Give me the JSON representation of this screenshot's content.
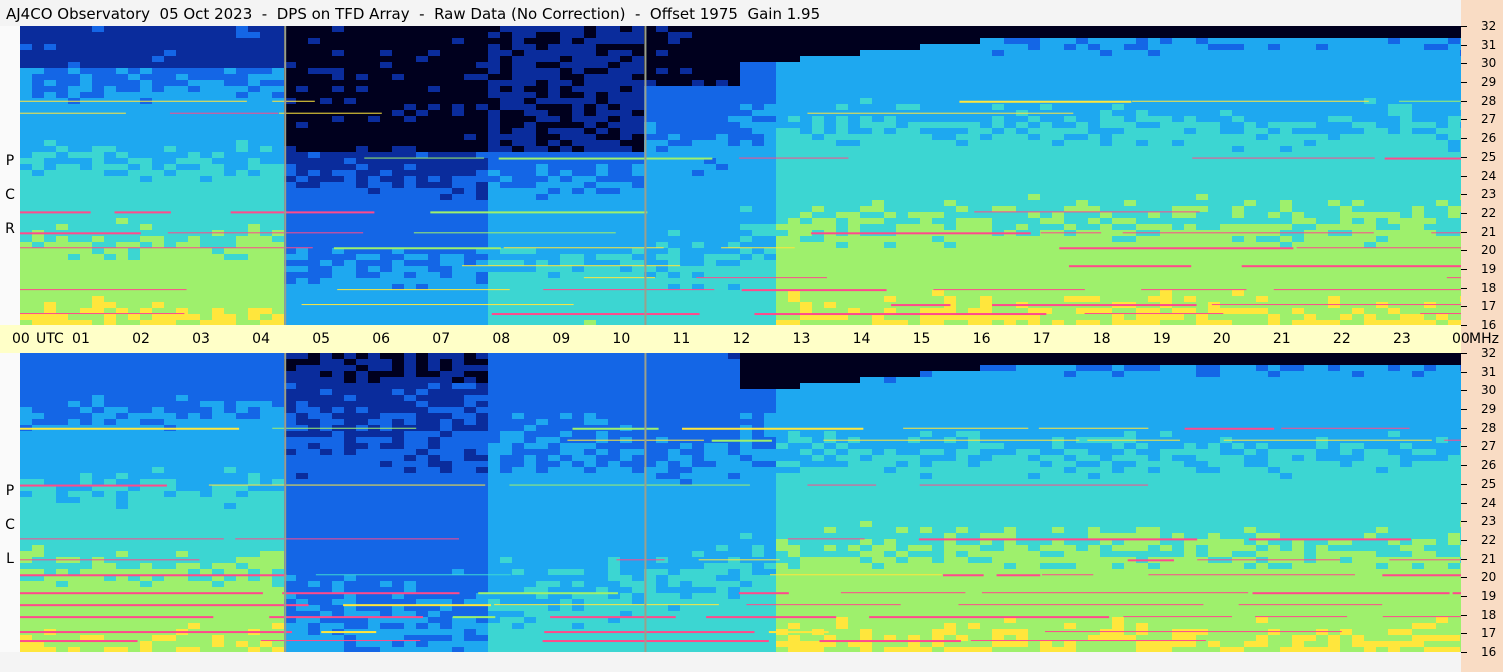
{
  "header": {
    "title": "AJ4CO Observatory  05 Oct 2023  -  DPS on TFD Array  -  Raw Data (No Correction)  -  Offset 1975  Gain 1.95"
  },
  "panels": {
    "top": {
      "label": [
        "R",
        "C",
        "P"
      ]
    },
    "bottom": {
      "label": [
        "L",
        "C",
        "P"
      ]
    }
  },
  "chart_data": {
    "type": "heatmap",
    "title": "AJ4CO Observatory  05 Oct 2023  -  DPS on TFD Array  -  Raw Data (No Correction)  -  Offset 1975  Gain 1.95",
    "x_ticks": [
      "00",
      "01",
      "02",
      "03",
      "04",
      "05",
      "06",
      "07",
      "08",
      "09",
      "10",
      "11",
      "12",
      "13",
      "14",
      "15",
      "16",
      "17",
      "18",
      "19",
      "20",
      "21",
      "22",
      "23",
      "00"
    ],
    "x_unit": "UTC",
    "y_ticks": [
      32,
      31,
      30,
      29,
      28,
      27,
      26,
      25,
      24,
      23,
      22,
      21,
      20,
      19,
      18,
      17,
      16
    ],
    "y_unit": "MHz",
    "xlim": [
      0,
      24
    ],
    "ylim": [
      16,
      32
    ],
    "panels": [
      "RCP",
      "LCP"
    ],
    "colormap": [
      "#00001e",
      "#0a2c9c",
      "#1466e6",
      "#1ea8f0",
      "#3cd6d2",
      "#9ef06c",
      "#ffe63c",
      "#ff4a8c"
    ],
    "vertical_markers_utc": [
      4.4,
      10.4
    ]
  }
}
